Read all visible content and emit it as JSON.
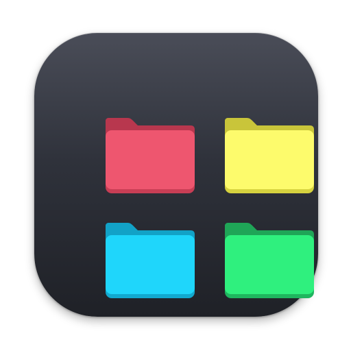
{
  "app_icon": {
    "icon": "folder-grid-app-icon",
    "background_top": "#4a4d58",
    "background_bottom": "#1f2127"
  },
  "folders": [
    {
      "icon": "red-folder-icon",
      "back": "#b8374e",
      "front": "#ee566f",
      "bottom": "#c83e55"
    },
    {
      "icon": "yellow-folder-icon",
      "back": "#c9c53a",
      "front": "#fdfb6c",
      "bottom": "#d6d23f"
    },
    {
      "icon": "cyan-folder-icon",
      "back": "#12a2c7",
      "front": "#1fd6fb",
      "bottom": "#12a9cf"
    },
    {
      "icon": "green-folder-icon",
      "back": "#1fa557",
      "front": "#2ff07e",
      "bottom": "#1fb65f"
    }
  ]
}
